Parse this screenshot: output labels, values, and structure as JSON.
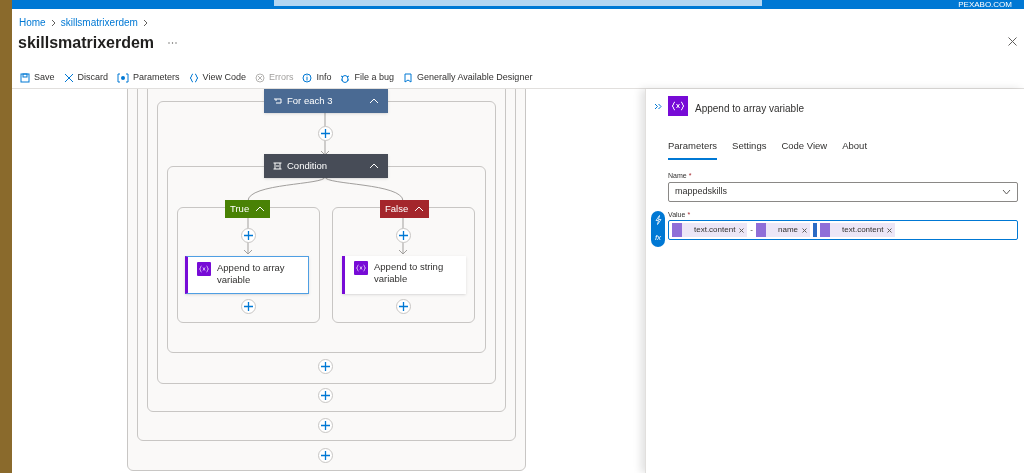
{
  "top_bar": {
    "account": "PEXABO.COM"
  },
  "breadcrumb": [
    "Home",
    "skillsmatrixerdem"
  ],
  "title": "skillsmatrixerdem",
  "toolbar": [
    {
      "kind": "save",
      "label": "Save",
      "disabled": false
    },
    {
      "kind": "discard",
      "label": "Discard",
      "disabled": false
    },
    {
      "kind": "parameters",
      "label": "Parameters",
      "disabled": false
    },
    {
      "kind": "code",
      "label": "View Code",
      "disabled": false
    },
    {
      "kind": "errors",
      "label": "Errors",
      "disabled": true
    },
    {
      "kind": "info",
      "label": "Info",
      "disabled": false
    },
    {
      "kind": "bug",
      "label": "File a bug",
      "disabled": false
    },
    {
      "kind": "designer",
      "label": "Generally Available Designer",
      "disabled": false
    }
  ],
  "canvas": {
    "loop": {
      "title": "For each 3"
    },
    "condition": {
      "title": "Condition"
    },
    "branches": [
      {
        "kind": "true",
        "label": "True",
        "action": "Append to array variable",
        "selected": true
      },
      {
        "kind": "false",
        "label": "False",
        "action": "Append to string variable",
        "selected": false
      }
    ]
  },
  "panel": {
    "title": "Append to array variable",
    "tabs": [
      {
        "label": "Parameters",
        "selected": true
      },
      {
        "label": "Settings",
        "selected": false
      },
      {
        "label": "Code View",
        "selected": false
      },
      {
        "label": "About",
        "selected": false
      }
    ],
    "name_field": {
      "label": "Name",
      "required_marker": "*",
      "value": "mappedskills"
    },
    "value_field": {
      "label": "Value",
      "required_marker": "*",
      "function_button": "fx",
      "parts": [
        {
          "kind": "token",
          "text": "text.content"
        },
        {
          "kind": "text",
          "text": "-"
        },
        {
          "kind": "token",
          "text": "name"
        },
        {
          "kind": "cursor"
        },
        {
          "kind": "token",
          "text": "text.content"
        }
      ]
    }
  }
}
